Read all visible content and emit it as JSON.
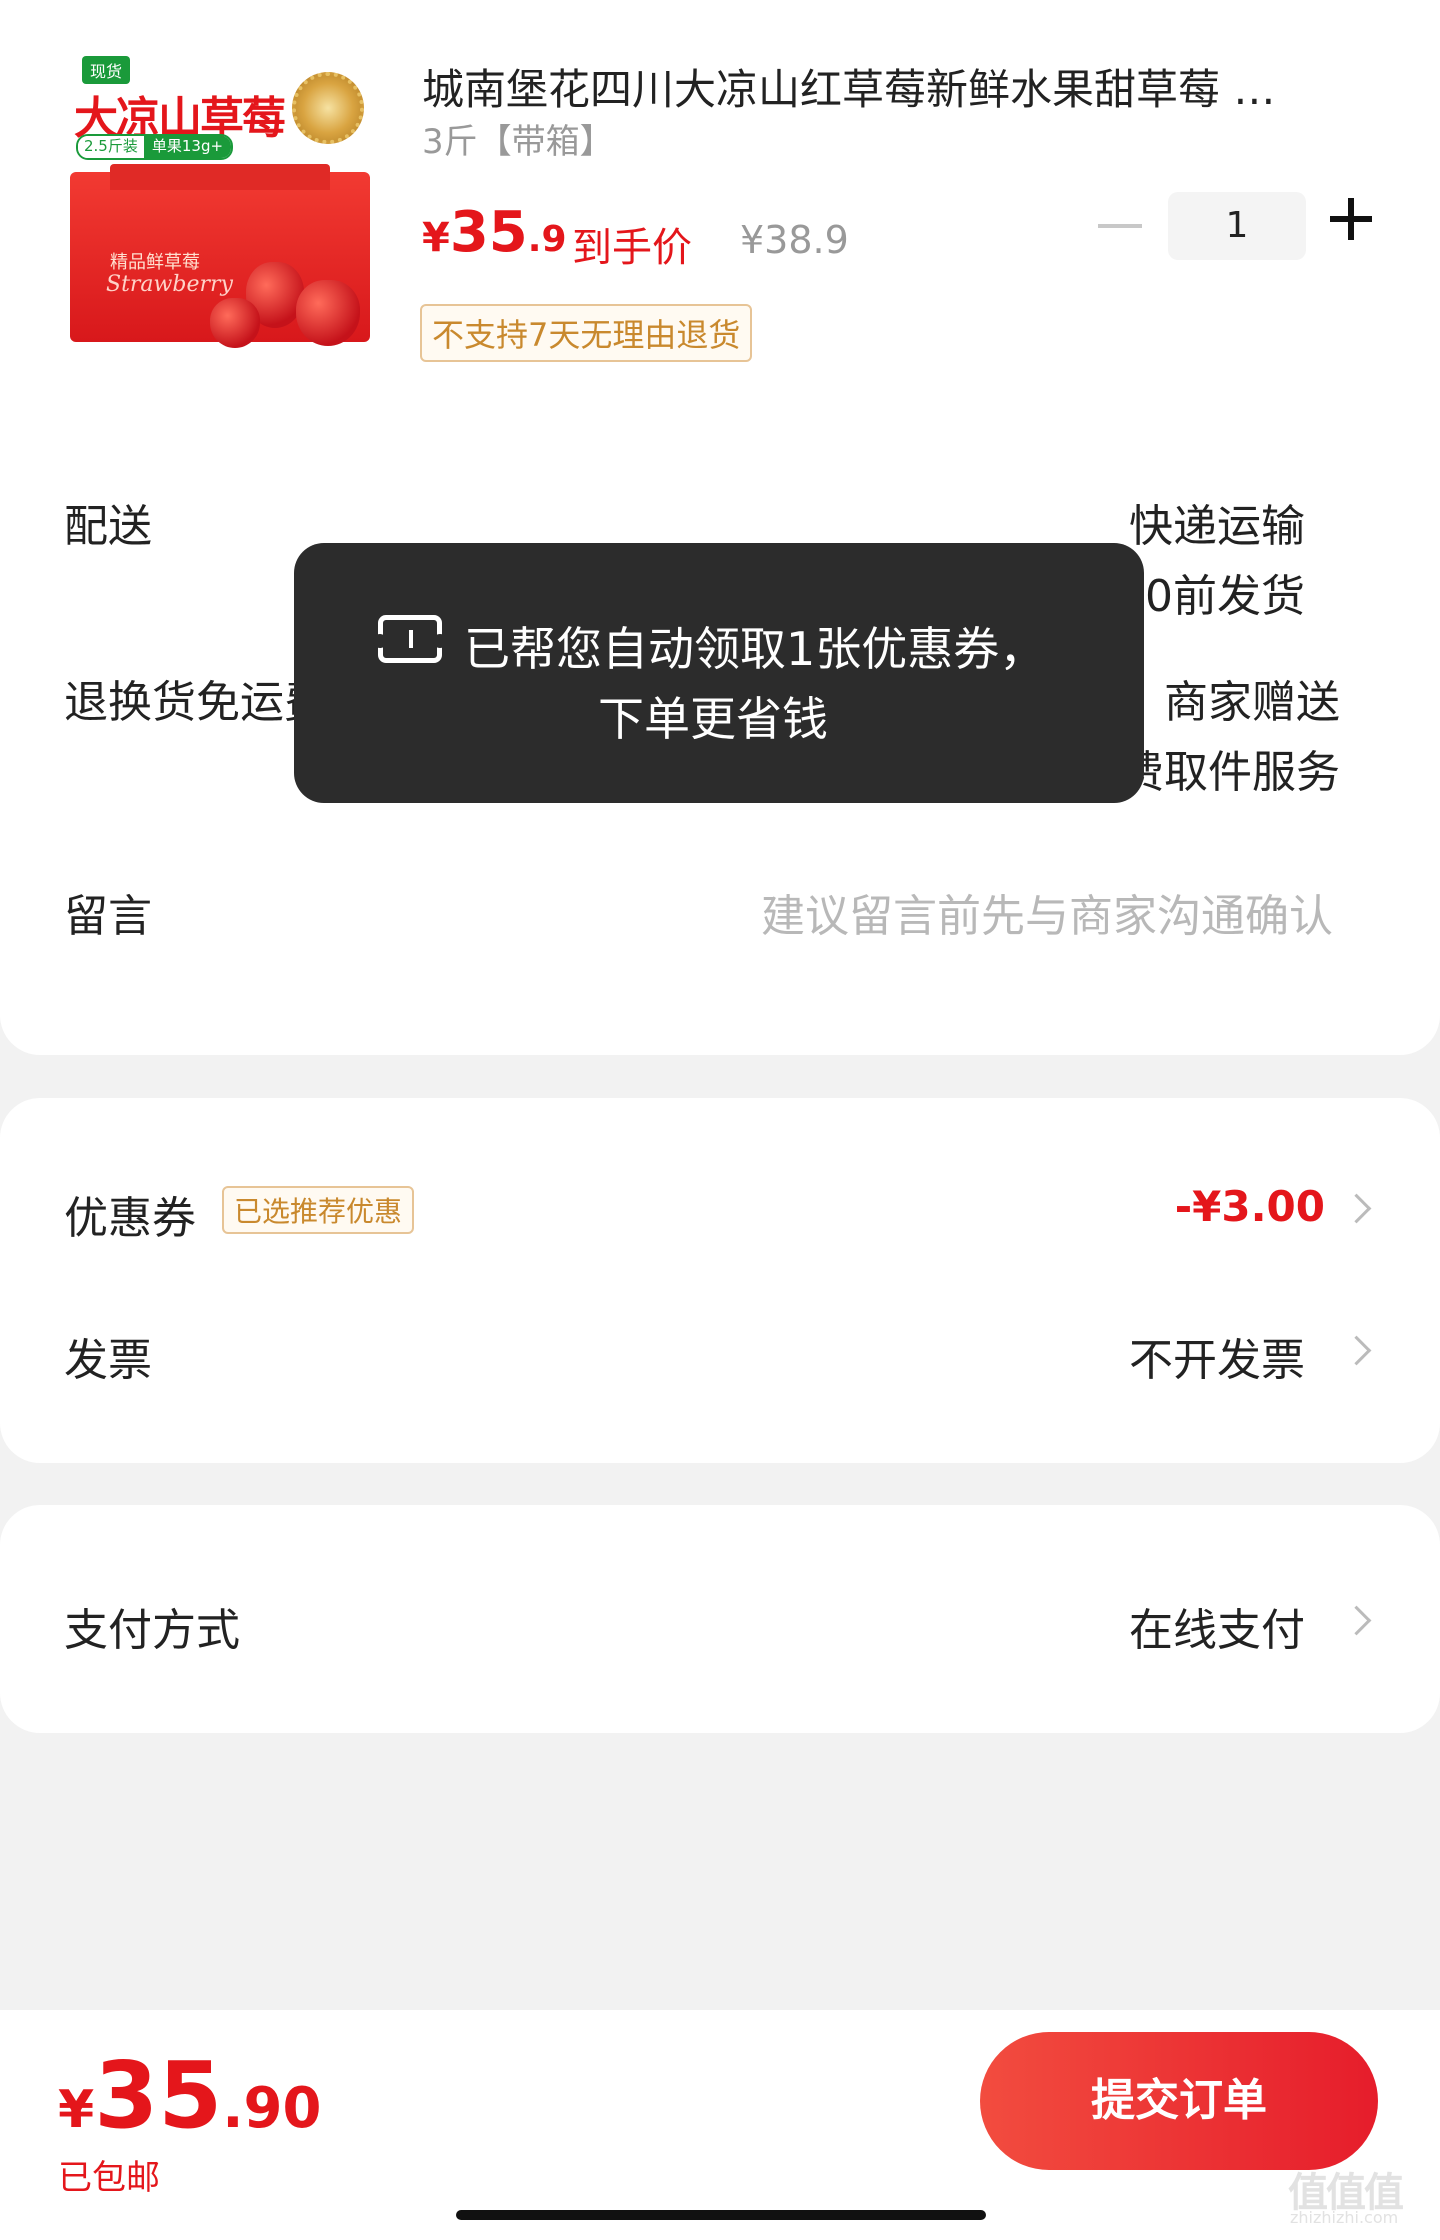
{
  "product": {
    "image_badge": "现货",
    "image_title": "大凉山草莓",
    "image_spec_a": "2.5斤装",
    "image_spec_b": "单果13g+",
    "image_box_text": "精品鲜草莓",
    "image_box_script": "Strawberry",
    "title": "城南堡花四川大凉山红草莓新鲜水果甜草莓 …",
    "spec": "3斤【带箱】",
    "price_symbol": "¥",
    "price_int": "35",
    "price_dec": ".9",
    "price_label": "到手价",
    "original_price": "¥38.9",
    "quantity": "1",
    "return_policy": "不支持7天无理由退货"
  },
  "delivery": {
    "label": "配送",
    "value": "快递运输",
    "estimate": "预计2月28日24:00前发货"
  },
  "return_shipping": {
    "label": "退换货免运费",
    "value": "商家赠送",
    "detail": "享运费补贴或免费取件服务"
  },
  "message": {
    "label": "留言",
    "placeholder": "建议留言前先与商家沟通确认"
  },
  "coupon": {
    "label": "优惠券",
    "tag": "已选推荐优惠",
    "value": "-¥3.00"
  },
  "invoice": {
    "label": "发票",
    "value": "不开发票"
  },
  "payment": {
    "label": "支付方式",
    "value": "在线支付"
  },
  "toast": {
    "line1": "已帮您自动领取1张优惠券，",
    "line2": "下单更省钱"
  },
  "footer": {
    "total_symbol": "¥",
    "total_int": "35",
    "total_dec": ".90",
    "shipping_note": "已包邮",
    "submit_label": "提交订单"
  },
  "watermark": {
    "glyphs": "值值值",
    "site": "zhizhizhi.com"
  },
  "colors": {
    "accent": "#e4161b",
    "tag_text": "#c9892e",
    "toast_bg": "#2c2c2c"
  }
}
